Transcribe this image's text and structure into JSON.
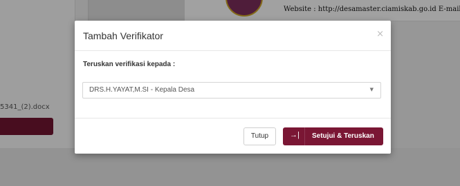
{
  "background": {
    "website_text": "Website : http://desamaster.ciamiskab.go.id  E-mail : r",
    "file_name": "5341_(2).docx"
  },
  "modal": {
    "title": "Tambah Verifikator",
    "close_glyph": "×",
    "field_label": "Teruskan verifikasi kepada :",
    "select": {
      "selected_value": "DRS.H.YAYAT,M.SI - Kepala Desa",
      "caret_glyph": "▼"
    },
    "buttons": {
      "close_label": "Tutup",
      "approve_icon": "→|",
      "approve_label": "Setujui & Teruskan"
    }
  },
  "colors": {
    "accent": "#7a1634",
    "overlay": "rgba(0,0,0,0.35)"
  }
}
